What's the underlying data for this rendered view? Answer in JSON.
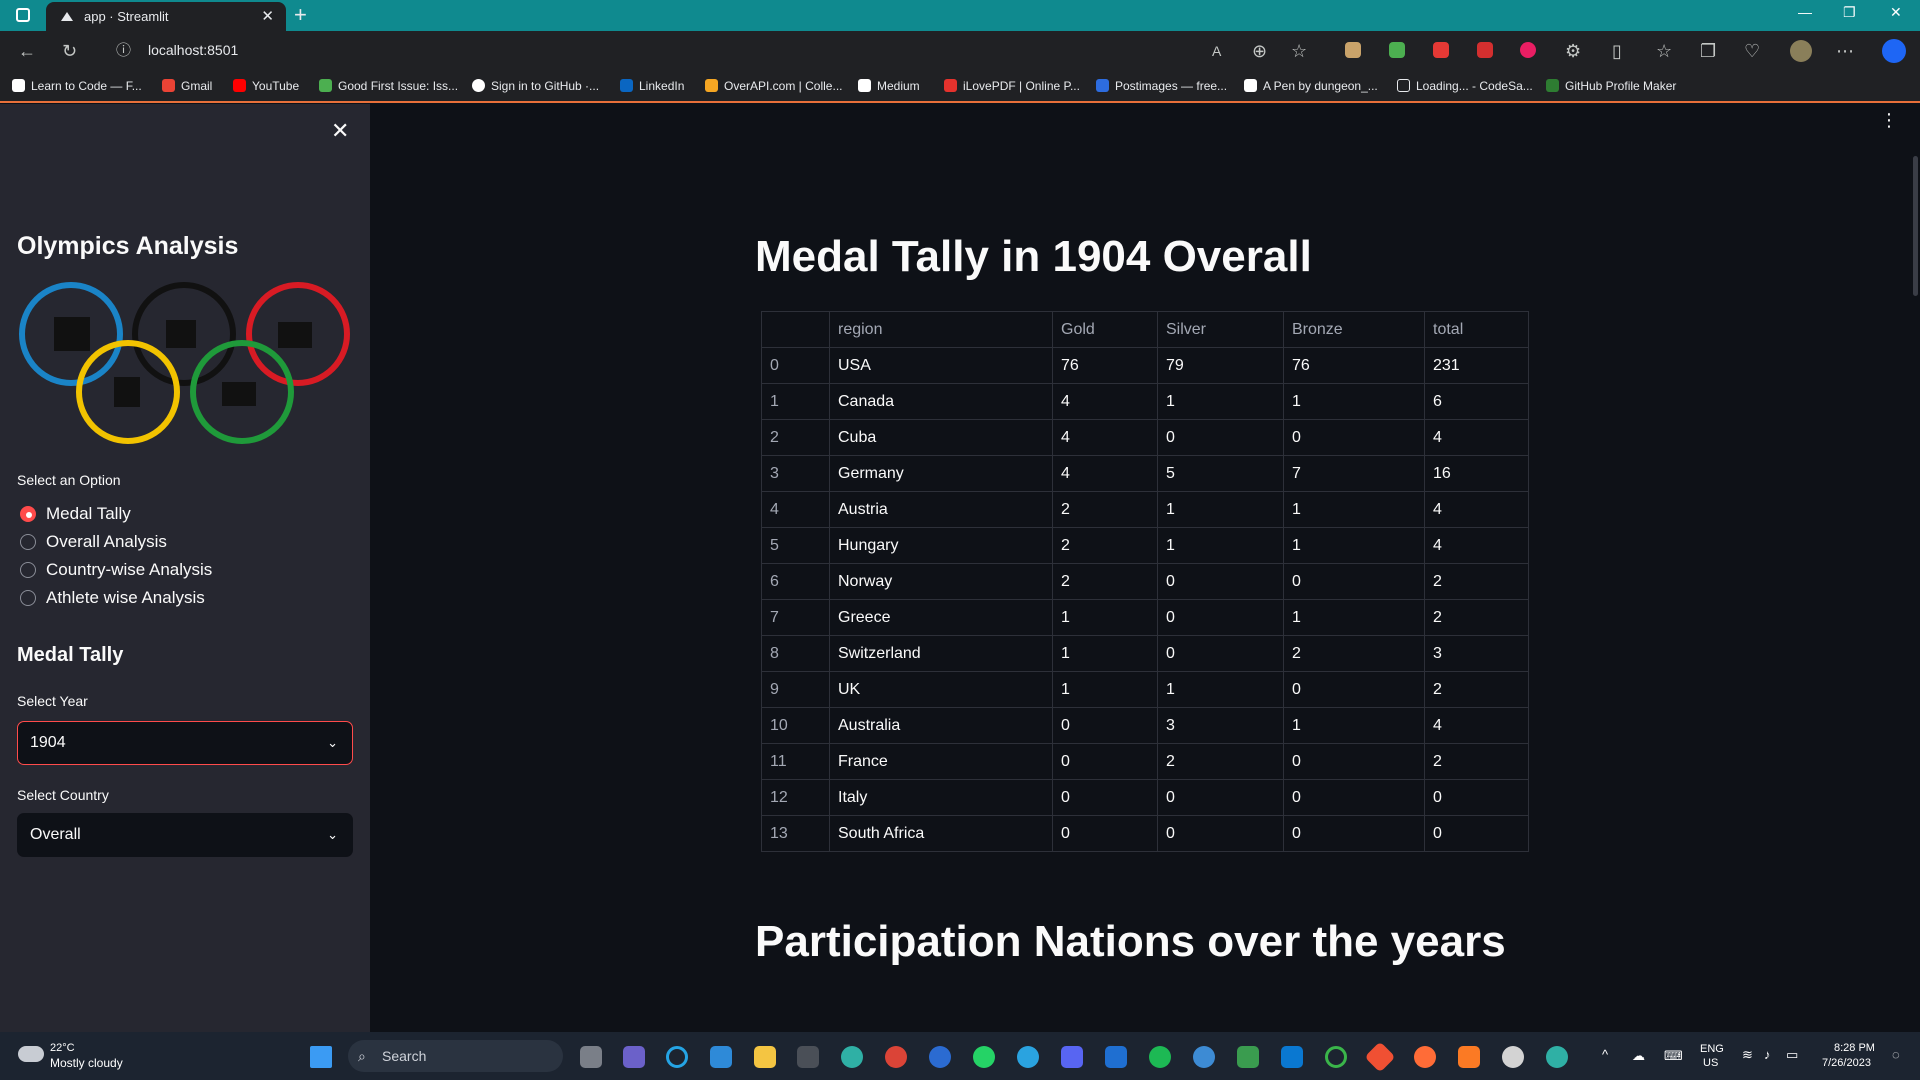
{
  "browser": {
    "tab_title": "app · Streamlit",
    "tab_close": "✕",
    "new_tab": "+",
    "url": "localhost:8501",
    "bookmarks": [
      "Learn to Code — F...",
      "Gmail",
      "YouTube",
      "Good First Issue: Iss...",
      "Sign in to GitHub ·...",
      "LinkedIn",
      "OverAPI.com | Colle...",
      "Medium",
      "iLovePDF | Online P...",
      "Postimages — free...",
      "A Pen by dungeon_...",
      "Loading... - CodeSa...",
      "GitHub Profile Maker"
    ]
  },
  "sidebar": {
    "title": "Olympics Analysis",
    "option_label": "Select an Option",
    "options": [
      "Medal Tally",
      "Overall Analysis",
      "Country-wise Analysis",
      "Athlete wise Analysis"
    ],
    "selected_option": "Medal Tally",
    "section_title": "Medal Tally",
    "year_label": "Select Year",
    "year_value": "1904",
    "country_label": "Select Country",
    "country_value": "Overall"
  },
  "main": {
    "heading": "Medal Tally in 1904 Overall",
    "second_heading": "Participation Nations over the years",
    "table": {
      "columns": [
        "",
        "region",
        "Gold",
        "Silver",
        "Bronze",
        "total"
      ],
      "rows": [
        [
          "0",
          "USA",
          "76",
          "79",
          "76",
          "231"
        ],
        [
          "1",
          "Canada",
          "4",
          "1",
          "1",
          "6"
        ],
        [
          "2",
          "Cuba",
          "4",
          "0",
          "0",
          "4"
        ],
        [
          "3",
          "Germany",
          "4",
          "5",
          "7",
          "16"
        ],
        [
          "4",
          "Austria",
          "2",
          "1",
          "1",
          "4"
        ],
        [
          "5",
          "Hungary",
          "2",
          "1",
          "1",
          "4"
        ],
        [
          "6",
          "Norway",
          "2",
          "0",
          "0",
          "2"
        ],
        [
          "7",
          "Greece",
          "1",
          "0",
          "1",
          "2"
        ],
        [
          "8",
          "Switzerland",
          "1",
          "0",
          "2",
          "3"
        ],
        [
          "9",
          "UK",
          "1",
          "1",
          "0",
          "2"
        ],
        [
          "10",
          "Australia",
          "0",
          "3",
          "1",
          "4"
        ],
        [
          "11",
          "France",
          "0",
          "2",
          "0",
          "2"
        ],
        [
          "12",
          "Italy",
          "0",
          "0",
          "0",
          "0"
        ],
        [
          "13",
          "South Africa",
          "0",
          "0",
          "0",
          "0"
        ]
      ]
    }
  },
  "taskbar": {
    "weather_temp": "22°C",
    "weather_desc": "Mostly cloudy",
    "search_placeholder": "Search",
    "lang": "ENG",
    "region": "US",
    "time": "8:28 PM",
    "date": "7/26/2023"
  },
  "colors": {
    "accent": "#ff4b4b",
    "tab_bar": "#0f8a8f",
    "main_bg": "#0e1117",
    "sidebar_bg": "#262730"
  }
}
